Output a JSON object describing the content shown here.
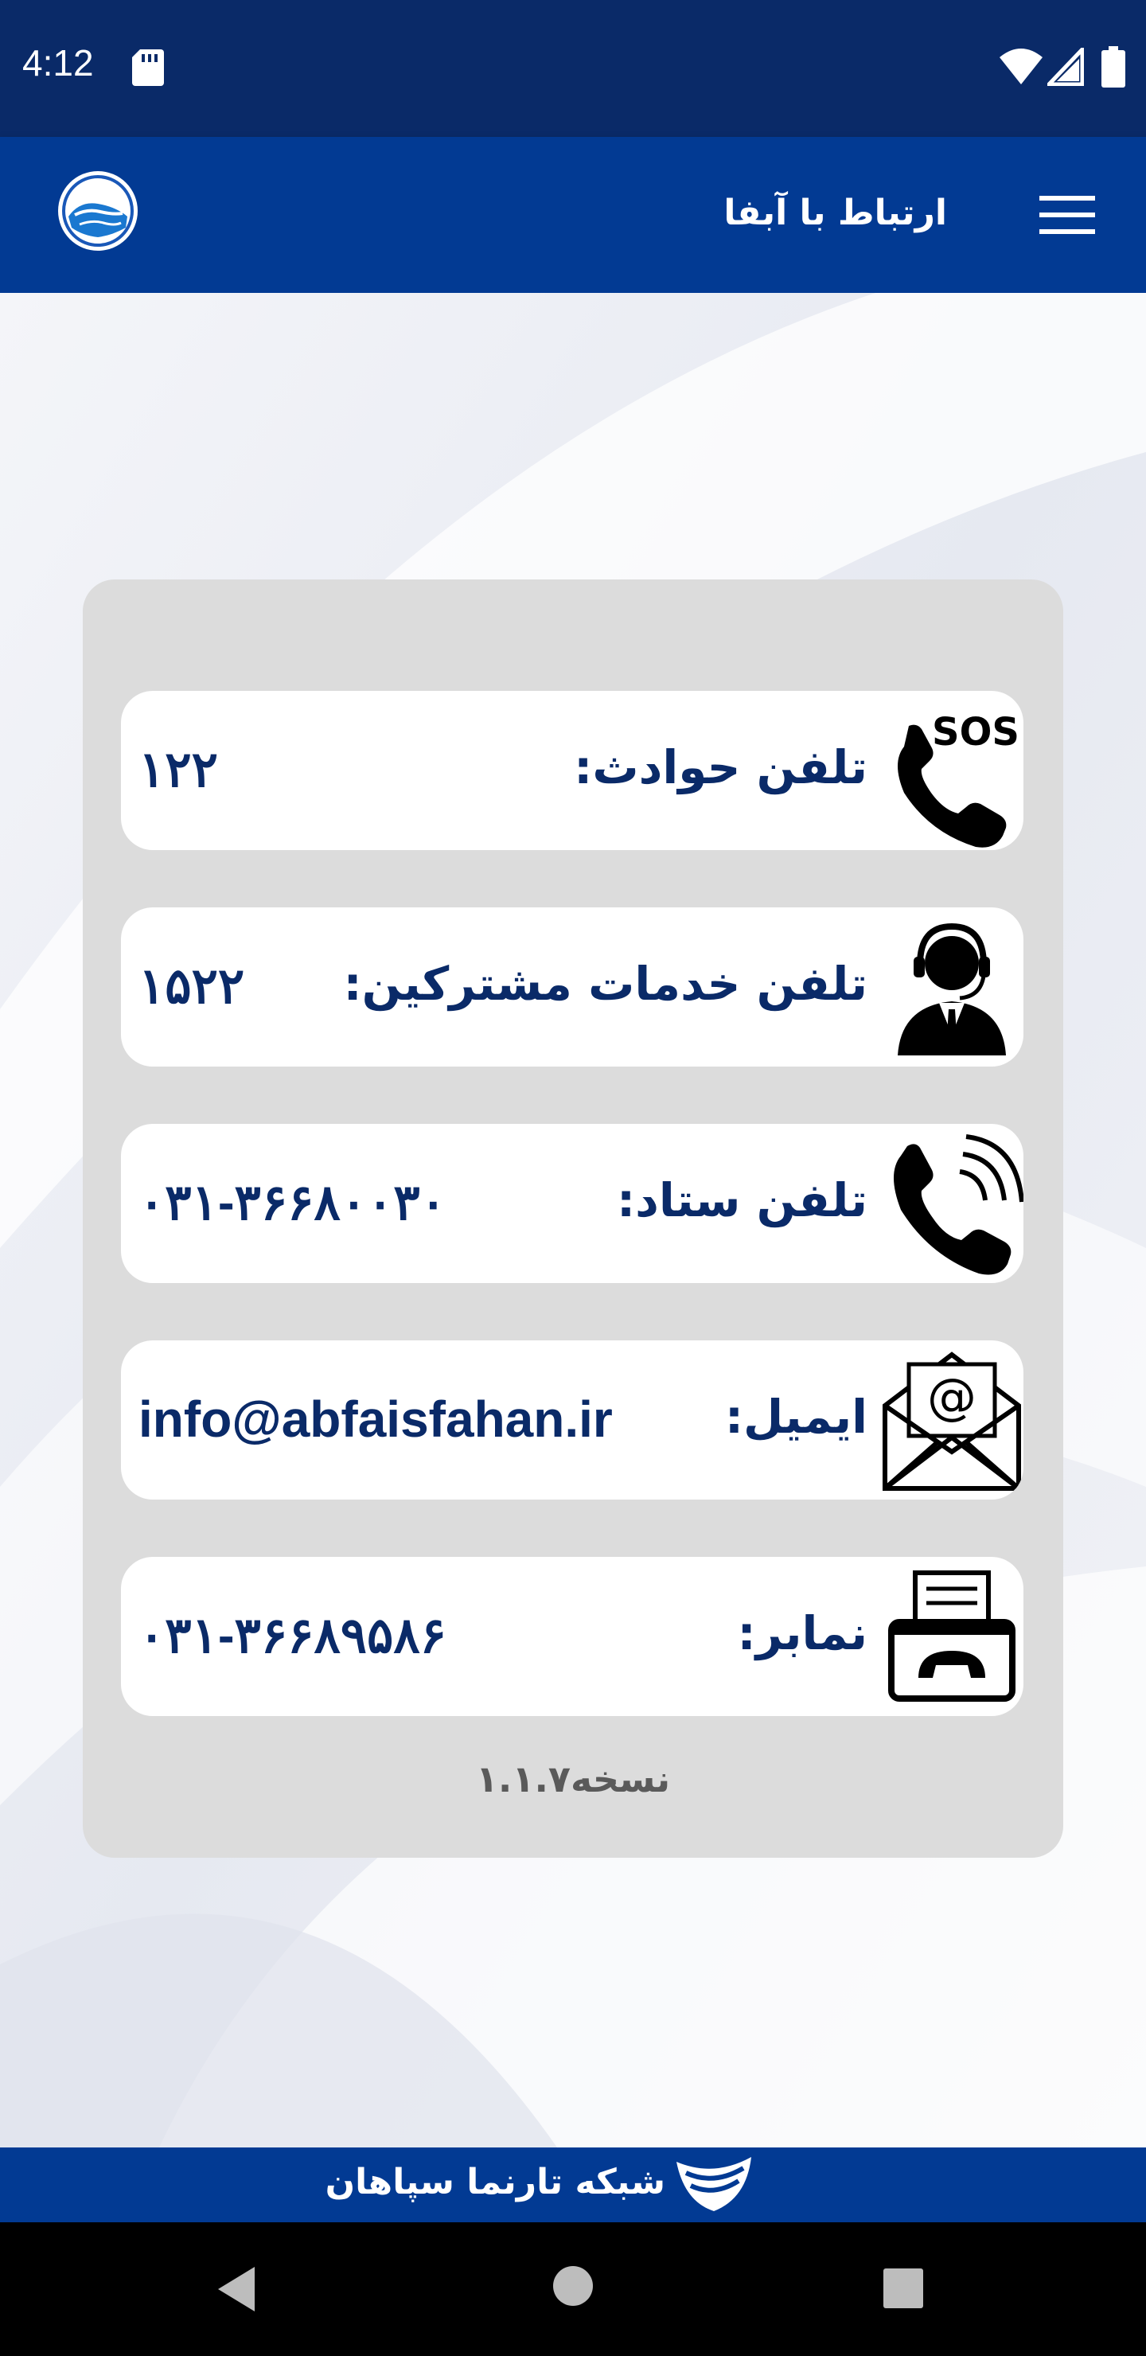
{
  "status_bar": {
    "time": "4:12"
  },
  "app_bar": {
    "title": "ارتباط با آبفا"
  },
  "contacts": [
    {
      "icon": "sos-phone-icon",
      "label": "تلفن حوادث:",
      "value": "۱۲۲"
    },
    {
      "icon": "customer-service-icon",
      "label": "تلفن خدمات مشترکین:",
      "value": "۱۵۲۲"
    },
    {
      "icon": "phone-ringing-icon",
      "label": "تلفن ستاد:",
      "value": "۰۳۱-۳۶۶۸۰۰۳۰"
    },
    {
      "icon": "email-icon",
      "label": "ایمیل:",
      "value": "info@abfaisfahan.ir"
    },
    {
      "icon": "fax-icon",
      "label": "نمابر:",
      "value": "۰۳۱-۳۶۶۸۹۵۸۶"
    }
  ],
  "version": "نسخه۱.۱.۷",
  "footer": {
    "text": "شبکه تارنما سپاهان"
  },
  "colors": {
    "status_bar": "#0a2a68",
    "app_bar": "#023a93",
    "text_primary": "#0a2a68",
    "panel": "#dcdcdc"
  }
}
